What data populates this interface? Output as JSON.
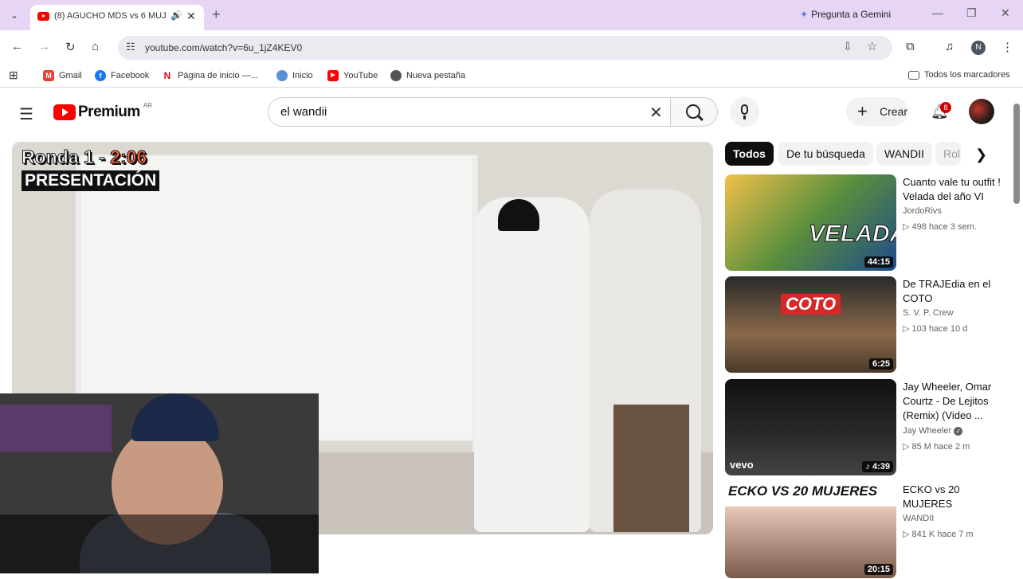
{
  "browser": {
    "tab_title": "(8) AGUCHO MDS vs 6 MUJ",
    "new_tab_glyph": "+",
    "gemini_label": "Pregunta a Gemini",
    "url": "youtube.com/watch?v=6u_1jZ4KEV0",
    "profile_initial": "N"
  },
  "bookmarks": {
    "items": [
      {
        "label": "Gmail",
        "icon_text": "M",
        "color": "#ea4335"
      },
      {
        "label": "Facebook",
        "icon_text": "f",
        "color": "#1877f2"
      },
      {
        "label": "Página de inicio —...",
        "icon_text": "N",
        "color": "#e50914"
      },
      {
        "label": "Inicio",
        "icon_text": "",
        "color": "#5b8fd6"
      },
      {
        "label": "YouTube",
        "icon_text": "▶",
        "color": "#ff0000"
      },
      {
        "label": "Nueva pestaña",
        "icon_text": "",
        "color": "#555555"
      }
    ],
    "all_label": "Todos los marcadores"
  },
  "youtube": {
    "logo_text": "Premium",
    "region": "AR",
    "search_value": "el wandii",
    "create_label": "Crear",
    "notif_count": "8"
  },
  "player": {
    "overlay_round": "Ronda 1 - ",
    "overlay_time": "2:06",
    "overlay_caption": "PRESENTACIÓN"
  },
  "chips": [
    "Todos",
    "De tu búsqueda",
    "WANDII",
    "Rol"
  ],
  "recommendations": [
    {
      "title": "Cuanto vale tu outfit ! Velada del año VI",
      "channel": "JordoRivs",
      "views": "498",
      "age": "hace 3 sem.",
      "duration": "44:15",
      "thumb_text": "VELADA",
      "verified": false
    },
    {
      "title": "De TRAJEdia en el COTO",
      "channel": "S. V. P. Crew",
      "views": "103",
      "age": "hace 10 d",
      "duration": "6:25",
      "thumb_text": "COTO",
      "verified": false
    },
    {
      "title": "Jay Wheeler, Omar Courtz - De Lejitos (Remix) (Video ...",
      "channel": "Jay Wheeler",
      "views": "85 M",
      "age": "hace 2 m",
      "duration": "4:39",
      "thumb_text": "vevo",
      "verified": true
    },
    {
      "title": "ECKO vs 20 MUJERES",
      "channel": "WANDII",
      "views": "841 K",
      "age": "hace 7 m",
      "duration": "20:15",
      "thumb_text": "ECKO VS 20 MUJERES",
      "verified": false
    }
  ],
  "colors": {
    "accent": "#ff0000",
    "tabstrip": "#e7d5f5",
    "badge": "#cc0000"
  }
}
